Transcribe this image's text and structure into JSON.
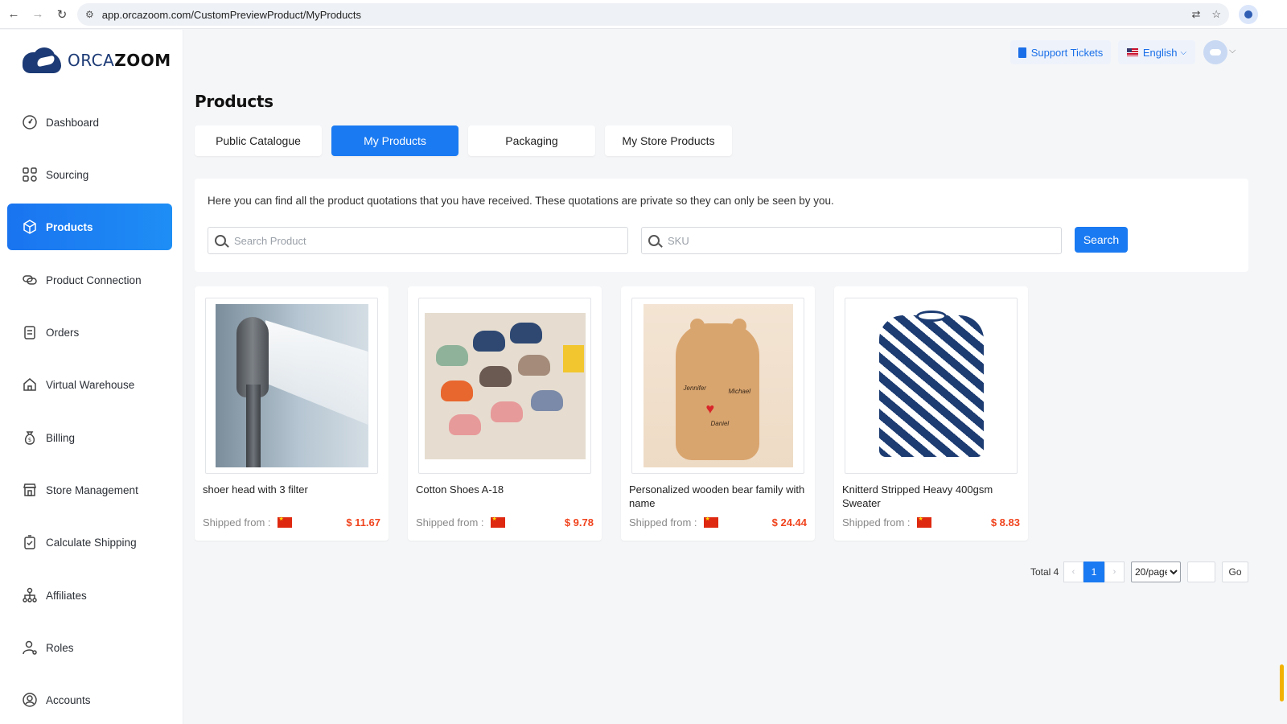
{
  "browser": {
    "url": "app.orcazoom.com/CustomPreviewProduct/MyProducts"
  },
  "logo": {
    "part_a": "ORCA",
    "part_b": "ZOOM"
  },
  "sidebar": {
    "items": [
      {
        "label": "Dashboard",
        "icon": "dashboard-icon"
      },
      {
        "label": "Sourcing",
        "icon": "grid-icon"
      },
      {
        "label": "Products",
        "icon": "box-icon",
        "active": true
      },
      {
        "label": "Product Connection",
        "icon": "link-icon"
      },
      {
        "label": "Orders",
        "icon": "clipboard-icon"
      },
      {
        "label": "Virtual Warehouse",
        "icon": "house-icon"
      },
      {
        "label": "Billing",
        "icon": "money-bag-icon"
      },
      {
        "label": "Store Management",
        "icon": "store-icon"
      },
      {
        "label": "Calculate Shipping",
        "icon": "calculator-icon"
      },
      {
        "label": "Affiliates",
        "icon": "network-icon"
      },
      {
        "label": "Roles",
        "icon": "user-gear-icon"
      },
      {
        "label": "Accounts",
        "icon": "account-icon"
      }
    ]
  },
  "header": {
    "support_label": "Support Tickets",
    "language_label": "English"
  },
  "main": {
    "title": "Products",
    "tabs": [
      {
        "label": "Public Catalogue"
      },
      {
        "label": "My Products",
        "active": true
      },
      {
        "label": "Packaging"
      },
      {
        "label": "My Store Products"
      }
    ],
    "note": "Here you can find all the product quotations that you have received. These quotations are private so they can only be seen by you.",
    "search_placeholder": "Search Product",
    "sku_placeholder": "SKU",
    "search_button": "Search"
  },
  "products": [
    {
      "name": "shoer head with 3 filter",
      "shipped_label": "Shipped from :",
      "price": "$ 11.67"
    },
    {
      "name": "Cotton Shoes A-18",
      "shipped_label": "Shipped from :",
      "price": "$ 9.78"
    },
    {
      "name": "Personalized wooden bear family with name",
      "shipped_label": "Shipped from :",
      "price": "$ 24.44"
    },
    {
      "name": "Knitterd Stripped Heavy 400gsm Sweater",
      "shipped_label": "Shipped from :",
      "price": "$ 8.83"
    }
  ],
  "bear_names": [
    "Jennifer",
    "Michael",
    "Daniel"
  ],
  "pagination": {
    "total_label": "Total 4",
    "prev": "‹",
    "current_page": "1",
    "next": "›",
    "page_size": "20/page",
    "go_label": "Go"
  },
  "colors": {
    "accent": "#1a7af2",
    "price": "#f0441e",
    "brand_dark": "#1c3a75"
  }
}
